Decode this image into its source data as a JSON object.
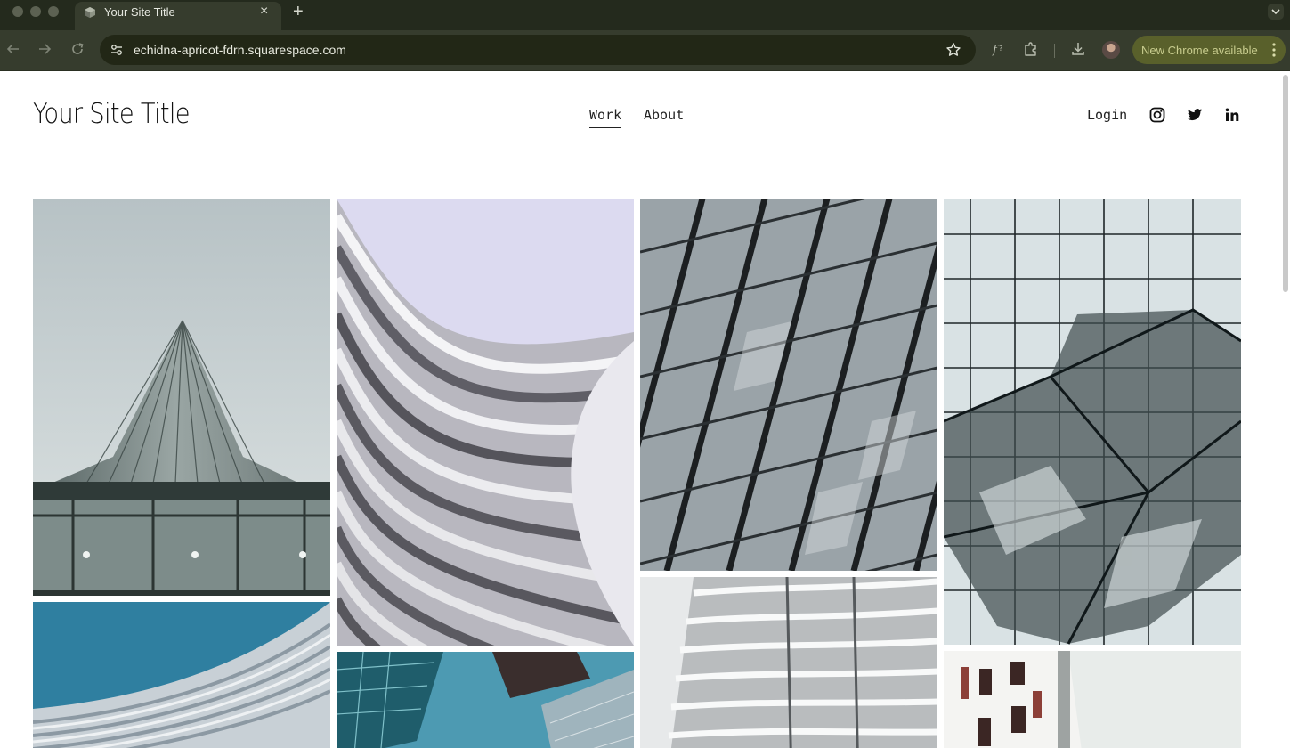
{
  "browser": {
    "tab_title": "Your Site Title",
    "tab_close_glyph": "×",
    "new_tab_glyph": "+",
    "url": "echidna-apricot-fdrn.squarespace.com",
    "update_label": "New Chrome available",
    "icons": [
      "back-icon",
      "forward-icon",
      "reload-icon",
      "site-settings-icon",
      "bookmark-star-icon",
      "formula-extension-icon",
      "extensions-puzzle-icon",
      "download-icon",
      "profile-avatar",
      "menu-dots-icon"
    ]
  },
  "site": {
    "title": "Your Site Title",
    "nav": [
      {
        "label": "Work",
        "active": true
      },
      {
        "label": "About",
        "active": false
      }
    ],
    "login_label": "Login",
    "social_icons": [
      "instagram-icon",
      "twitter-icon",
      "linkedin-icon"
    ]
  },
  "gallery": {
    "images": [
      "skyscraper-upward-view",
      "curved-white-facade",
      "diagonal-glass-windows",
      "reflective-glass-building",
      "blue-woven-facade",
      "teal-glass-towers",
      "white-balconies-building",
      "white-facade-windows"
    ]
  },
  "colors": {
    "tabbar_bg": "#242a1d",
    "toolbar_bg": "#363c2d",
    "omnibox_bg": "#222716",
    "update_chip_bg": "#59602b",
    "update_chip_text": "#c8cc8e"
  }
}
